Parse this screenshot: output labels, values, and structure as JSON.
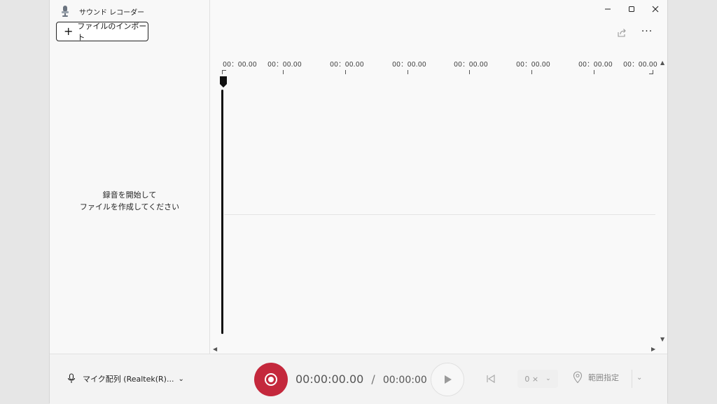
{
  "app": {
    "title": "サウンド レコーダー"
  },
  "sidebar": {
    "import_label": "ファイルのインポート",
    "empty_line1": "録音を開始して",
    "empty_line2": "ファイルを作成してください"
  },
  "window_controls": {
    "minimize": "—",
    "maximize": "▢",
    "close": "✕"
  },
  "toolbar": {
    "more": "···"
  },
  "timeline": {
    "ruler": [
      "00：00.00",
      "00：00.00",
      "00：00.00",
      "00：00.00",
      "00：00.00",
      "00：00.00",
      "00：00.00",
      "00：00.00"
    ]
  },
  "bottom": {
    "mic_label": "マイク配列 (Realtek(R)...",
    "current_time": "00:00:00.00",
    "separator": "/",
    "total_time": "00:00:00",
    "speed": "0 ×",
    "range_label": "範囲指定"
  },
  "colors": {
    "record": "#c4283c"
  }
}
